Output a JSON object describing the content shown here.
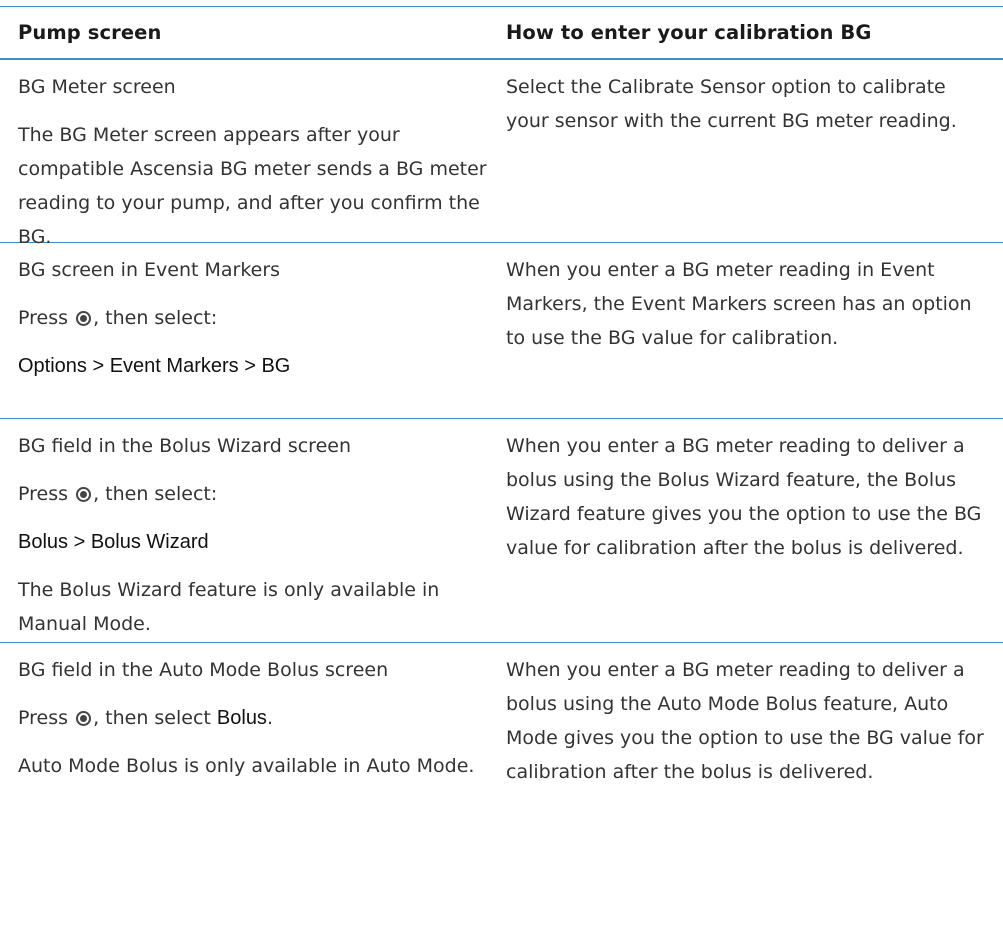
{
  "table": {
    "headers": {
      "pump_screen": "Pump screen",
      "how_to": "How to enter your calibration BG"
    },
    "rows": [
      {
        "left": {
          "title": "BG Meter screen",
          "text": "The BG Meter screen appears after your compatible Ascensia BG meter sends a BG meter reading to your pump, and after you confirm the BG."
        },
        "right": "Select the Calibrate Sensor option to calibrate your sensor with the current BG meter reading."
      },
      {
        "left": {
          "title": "BG screen in Event Markers",
          "press": "Press",
          "then_select": ", then select:",
          "menu_path": "Options > Event Markers > BG"
        },
        "right": "When you enter a BG meter reading in Event Markers, the Event Markers screen has an option to use the BG value for calibration."
      },
      {
        "left": {
          "title": "BG field in the Bolus Wizard screen",
          "press": "Press",
          "then_select": ", then select:",
          "menu_path": "Bolus > Bolus Wizard",
          "note": "The Bolus Wizard feature is only available in Manual Mode."
        },
        "right": "When you enter a BG meter reading to deliver a bolus using the Bolus Wizard feature, the Bolus Wizard feature gives you the option to use the BG value for calibration after the bolus is delivered."
      },
      {
        "left": {
          "title": "BG field in the Auto Mode Bolus screen",
          "press": "Press",
          "then_select": ", then select",
          "bold_option": "Bolus",
          "period": ".",
          "note": "Auto Mode Bolus is only available in Auto Mode."
        },
        "right": "When you enter a BG meter reading to deliver a bolus using the Auto Mode Bolus feature, Auto Mode gives you the option to use the BG value for calibration after the bolus is delivered."
      }
    ]
  },
  "icons": {
    "select_button": "select-button-icon"
  },
  "colors": {
    "rule": "#3d8fd0",
    "text": "#333333"
  }
}
